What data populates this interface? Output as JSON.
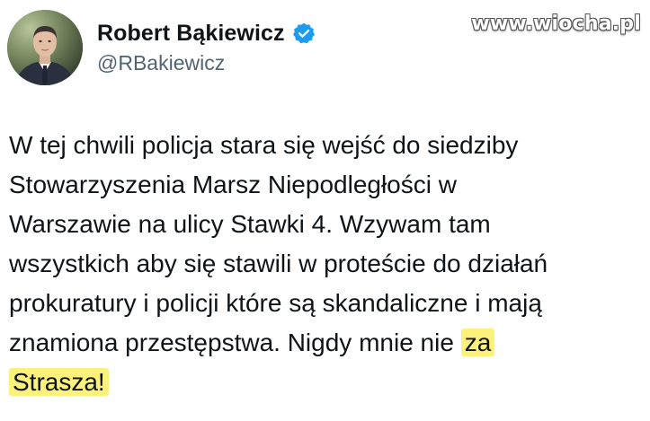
{
  "author": {
    "display_name": "Robert Bąkiewicz",
    "handle": "@RBakiewicz",
    "verified": true,
    "avatar_icon": "profile-photo"
  },
  "watermark": "www.wiocha.pl",
  "tweet": {
    "lines": [
      "W tej chwili policja stara się wejść do siedziby",
      "Stowarzyszenia Marsz Niepodległości w",
      "Warszawie na ulicy Stawki 4. Wzywam tam",
      "wszystkich aby się stawili w proteście do działań",
      "prokuratury i policji które są skandaliczne i mają"
    ],
    "line6_plain": "znamiona przestępstwa. Nigdy mnie nie",
    "line6_highlight": "za",
    "line7_highlight": "Strasza!"
  },
  "colors": {
    "verified_badge": "#1d9bf0",
    "highlight": "#fcf17a",
    "handle": "#536471",
    "text": "#0f1419"
  }
}
